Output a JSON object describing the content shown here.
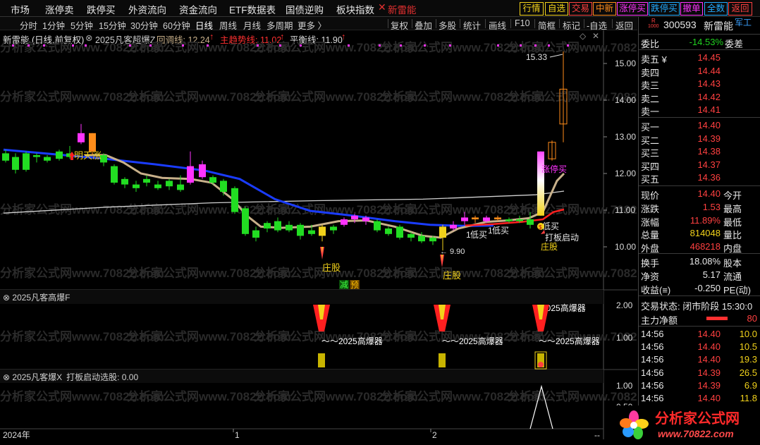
{
  "topnav": {
    "items": [
      "市场",
      "涨停卖",
      "跌停买",
      "外资流向",
      "资金流向",
      "ETF数据表",
      "国债逆购",
      "板块指数"
    ],
    "close_glyph": "✕",
    "red_tab": "新雷能",
    "quick": [
      "行情",
      "自选",
      "交易",
      "中新",
      "涨停买",
      "跌停买",
      "撤单",
      "全数",
      "返回"
    ]
  },
  "toolbar": {
    "left": [
      "分时",
      "1分钟",
      "5分钟",
      "15分钟",
      "30分钟",
      "60分钟",
      "日线",
      "周线",
      "月线",
      "多周期",
      "更多 〉"
    ],
    "active": "日线",
    "right": [
      "复权",
      "叠加",
      "多股",
      "统计",
      "画线",
      "F10",
      "简框",
      "标记",
      "-自选",
      "返回"
    ]
  },
  "infobar": {
    "stock": "新雷能 (日线,前复权)",
    "indicator": "2025凡客超爆Z",
    "pull_label": "回调线: 12.24",
    "main_label": "主趋势线: 11.02",
    "balance_label": "平衡线: 11.90",
    "arrow": "↑"
  },
  "main_chart": {
    "price_axis": [
      "15.00",
      "14.00",
      "13.00",
      "12.00",
      "11.00",
      "10.00"
    ],
    "high_label": "15.33",
    "low_label": "9.90",
    "annotations": {
      "mingtian": "明天涨",
      "zhuanggu": "庄股",
      "dimai": "低买",
      "jianjian": "减",
      "yu": "预",
      "dabanqidong": "打板启动",
      "zhangtingmai": "涨停买",
      "dimai_prefix": "1"
    },
    "colors": {
      "up": "#ff3b30",
      "down": "#22dd22",
      "magenta": "#ff33ff",
      "orange": "#ff8c1a",
      "ma_blue": "#1a3cff",
      "ma_white": "#d0d0d0",
      "ma_tan": "#c8b08a",
      "highlight": "#ffffff"
    }
  },
  "sub1": {
    "title": "2025凡客高爆F",
    "axis": [
      "2.00",
      "1.00"
    ],
    "label": "2025高爆器",
    "tilde_label": "～～2025高爆器"
  },
  "sub2": {
    "title": "2025凡客爆X",
    "value_label": "打板启动选股: 0.00",
    "axis": [
      "1.00",
      "0.50"
    ]
  },
  "time_axis": {
    "labels": [
      "2024年",
      "1",
      "2"
    ],
    "end": "--"
  },
  "quote": {
    "code": "300593",
    "name": "新雷能",
    "badge": "R",
    "badge_sub": "1000",
    "tag": "军工",
    "weibi_label": "委比",
    "weibi_value": "-14.53%",
    "weicha_label": "委差",
    "asks": [
      {
        "label": "卖五 ¥",
        "price": "14.45"
      },
      {
        "label": "卖四",
        "price": "14.44"
      },
      {
        "label": "卖三",
        "price": "14.43"
      },
      {
        "label": "卖二",
        "price": "14.42"
      },
      {
        "label": "卖一",
        "price": "14.41"
      }
    ],
    "bids": [
      {
        "label": "买一",
        "price": "14.40"
      },
      {
        "label": "买二",
        "price": "14.39"
      },
      {
        "label": "买三",
        "price": "14.38"
      },
      {
        "label": "买四",
        "price": "14.37"
      },
      {
        "label": "买五",
        "price": "14.36"
      }
    ],
    "stats": [
      {
        "label": "现价",
        "value": "14.40",
        "right": "今开",
        "color": "red"
      },
      {
        "label": "涨跌",
        "value": "1.53",
        "right": "最高",
        "color": "red"
      },
      {
        "label": "涨幅",
        "value": "11.89%",
        "right": "最低",
        "color": "red"
      },
      {
        "label": "总量",
        "value": "814048",
        "right": "量比",
        "color": "yellow"
      },
      {
        "label": "外盘",
        "value": "468218",
        "right": "内盘",
        "color": "red"
      }
    ],
    "stats2": [
      {
        "label": "换手",
        "value": "18.08%",
        "right": "股本",
        "color": "white"
      },
      {
        "label": "净资",
        "value": "5.17",
        "right": "流通",
        "color": "white"
      },
      {
        "label": "收益(≡)",
        "value": "-0.250",
        "right": "PE(动)",
        "color": "white"
      }
    ],
    "status_label": "交易状态: 闭市阶段 15:30:0",
    "flow_label": "主力净额",
    "flow_value": "80",
    "ticks": [
      {
        "time": "14:56",
        "price": "14.40",
        "vol": "10.0",
        "pcolor": "red"
      },
      {
        "time": "14:56",
        "price": "14.40",
        "vol": "10.5",
        "pcolor": "red"
      },
      {
        "time": "14:56",
        "price": "14.40",
        "vol": "19.3",
        "pcolor": "red"
      },
      {
        "time": "14:56",
        "price": "14.39",
        "vol": "26.5",
        "pcolor": "red"
      },
      {
        "time": "14:56",
        "price": "14.39",
        "vol": "6.9",
        "pcolor": "red"
      },
      {
        "time": "14:56",
        "price": "14.40",
        "vol": "11.8",
        "pcolor": "red"
      }
    ]
  },
  "logo": {
    "title": "分析家公式网",
    "url": "www.70822.com"
  },
  "watermark": "分析家公式网www.70822.com"
}
